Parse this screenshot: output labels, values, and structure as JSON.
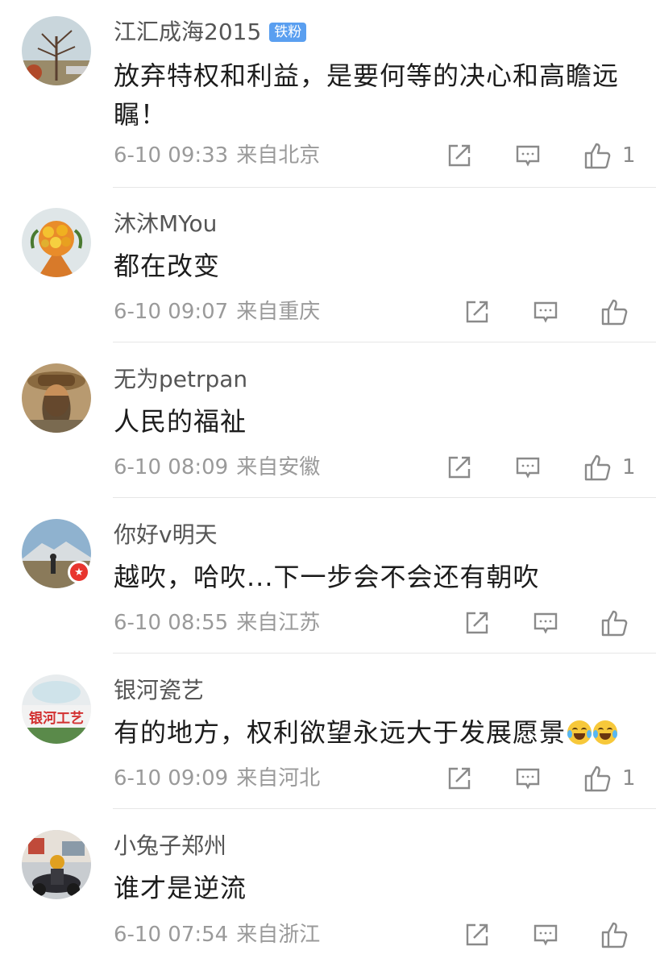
{
  "comments": [
    {
      "username": "江汇成海2015",
      "badge": "铁粉",
      "text": "放弃特权和利益，是要何等的决心和高瞻远瞩！",
      "time": "6-10 09:33",
      "location": "来自北京",
      "likes": "1"
    },
    {
      "username": "沐沐MYou",
      "text": "都在改变",
      "time": "6-10 09:07",
      "location": "来自重庆",
      "likes": ""
    },
    {
      "username": "无为petrpan",
      "text": "人民的福祉",
      "time": "6-10 08:09",
      "location": "来自安徽",
      "likes": "1"
    },
    {
      "username": "你好v明天",
      "text": "越吹，哈吹...下一步会不会还有朝吹",
      "time": "6-10 08:55",
      "location": "来自江苏",
      "likes": "",
      "verified_badge": true
    },
    {
      "username": "银河瓷艺",
      "text": "有的地方，权利欲望永远大于发展愿景",
      "time": "6-10 09:09",
      "location": "来自河北",
      "likes": "1",
      "emoji": "crying-laughing-emoji",
      "avatar_text": "银河工艺"
    },
    {
      "username": "小兔子郑州",
      "text": "谁才是逆流",
      "time": "6-10 07:54",
      "location": "来自浙江",
      "likes": ""
    }
  ],
  "icons": {
    "share": "share-icon",
    "reply": "comment-icon",
    "like": "thumbs-up-icon"
  },
  "colors": {
    "badge": "#5a9ff0",
    "meta_text": "#9a9a9a",
    "verified": "#e8352e"
  }
}
